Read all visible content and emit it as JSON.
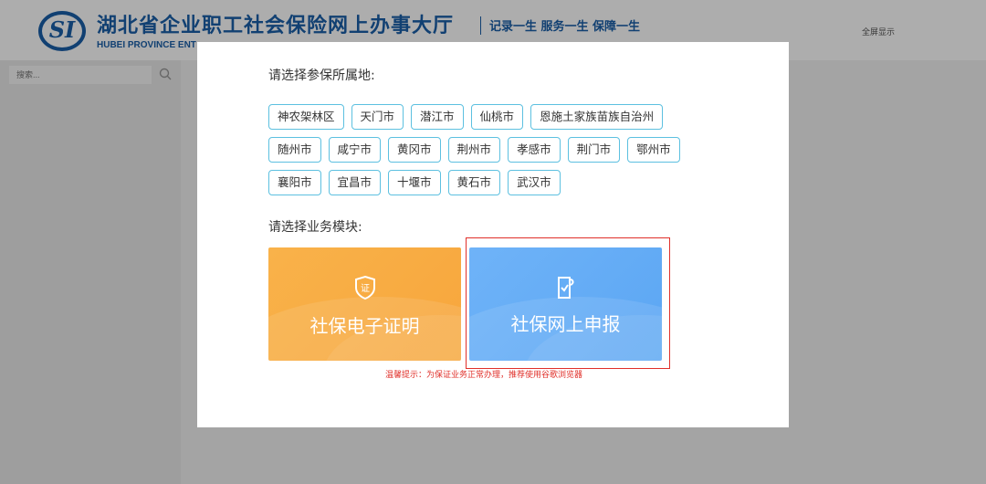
{
  "header": {
    "logo_text": "SI",
    "title": "湖北省企业职工社会保险网上办事大厅",
    "subtitle": "HUBEI PROVINCE ENT",
    "slogan": "记录一生 服务一生 保障一生",
    "fullscreen_label": "全屏显示"
  },
  "sidebar": {
    "search_placeholder": "搜索..."
  },
  "modal": {
    "region_prompt": "请选择参保所属地:",
    "regions_row1": [
      "神农架林区",
      "天门市",
      "潜江市",
      "仙桃市",
      "恩施土家族苗族自治州"
    ],
    "regions_row2": [
      "随州市",
      "咸宁市",
      "黄冈市",
      "荆州市",
      "孝感市",
      "荆门市",
      "鄂州市"
    ],
    "regions_row3": [
      "襄阳市",
      "宜昌市",
      "十堰市",
      "黄石市",
      "武汉市"
    ],
    "module_prompt": "请选择业务模块:",
    "modules": [
      {
        "label": "社保电子证明",
        "icon": "certificate-shield-icon",
        "color": "#f9ab40"
      },
      {
        "label": "社保网上申报",
        "icon": "document-check-icon",
        "color": "#62acf5"
      }
    ],
    "tip": "温馨提示：为保证业务正常办理，推荐使用谷歌浏览器"
  },
  "colors": {
    "brand_blue": "#1a5fa8",
    "tag_border": "#5cc0e0",
    "highlight_red": "#e0302a"
  }
}
